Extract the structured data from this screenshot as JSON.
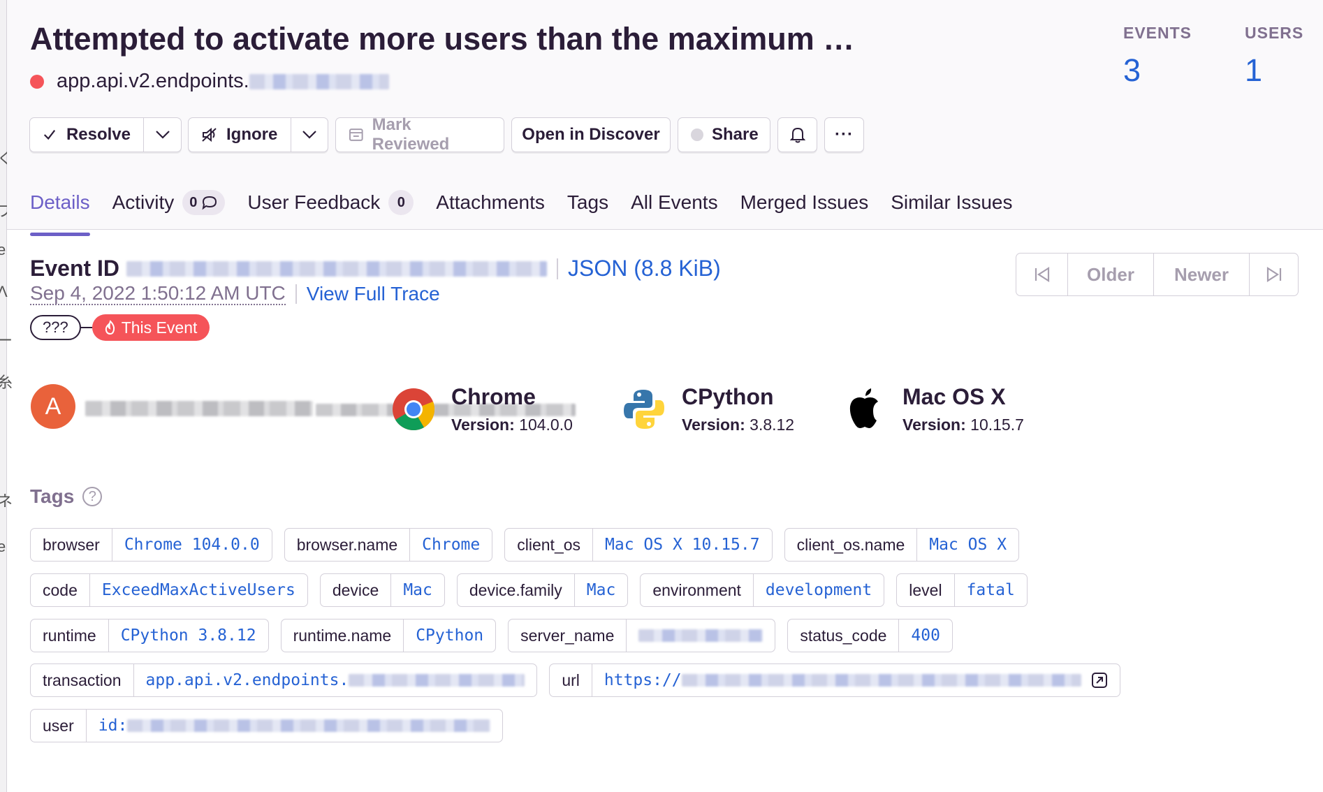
{
  "issue": {
    "title": "Attempted to activate more users than the maximum …",
    "culprit": "app.api.v2.endpoints."
  },
  "stats": [
    {
      "label": "EVENTS",
      "value": "3"
    },
    {
      "label": "USERS",
      "value": "1"
    }
  ],
  "actions": {
    "resolve": "Resolve",
    "ignore": "Ignore",
    "mark_reviewed": "Mark Reviewed",
    "open_discover": "Open in Discover",
    "share": "Share",
    "more": "···"
  },
  "tabs": [
    {
      "label": "Details"
    },
    {
      "label": "Activity",
      "badge": "0"
    },
    {
      "label": "User Feedback",
      "badge": "0"
    },
    {
      "label": "Attachments"
    },
    {
      "label": "Tags"
    },
    {
      "label": "All Events"
    },
    {
      "label": "Merged Issues"
    },
    {
      "label": "Similar Issues"
    }
  ],
  "event": {
    "id_label": "Event ID",
    "json_link": "JSON (8.8 KiB)",
    "date": "Sep 4, 2022 1:50:12 AM UTC",
    "trace_link": "View Full Trace",
    "trace_unknown": "???",
    "this_event": "This Event"
  },
  "pager": {
    "older": "Older",
    "newer": "Newer"
  },
  "contexts": {
    "user_initial": "A",
    "browser": {
      "name": "Chrome",
      "version_label": "Version:",
      "version": "104.0.0"
    },
    "runtime": {
      "name": "CPython",
      "version_label": "Version:",
      "version": "3.8.12"
    },
    "os": {
      "name": "Mac OS X",
      "version_label": "Version:",
      "version": "10.15.7"
    }
  },
  "tags_title": "Tags",
  "tags": [
    {
      "key": "browser",
      "value": "Chrome 104.0.0"
    },
    {
      "key": "browser.name",
      "value": "Chrome"
    },
    {
      "key": "client_os",
      "value": "Mac OS X 10.15.7"
    },
    {
      "key": "client_os.name",
      "value": "Mac OS X"
    },
    {
      "key": "code",
      "value": "ExceedMaxActiveUsers"
    },
    {
      "key": "device",
      "value": "Mac"
    },
    {
      "key": "device.family",
      "value": "Mac"
    },
    {
      "key": "environment",
      "value": "development"
    },
    {
      "key": "level",
      "value": "fatal"
    },
    {
      "key": "runtime",
      "value": "CPython 3.8.12"
    },
    {
      "key": "runtime.name",
      "value": "CPython"
    },
    {
      "key": "server_name",
      "value": ""
    },
    {
      "key": "status_code",
      "value": "400"
    },
    {
      "key": "transaction",
      "value": "app.api.v2.endpoints."
    },
    {
      "key": "url",
      "value": "https://"
    },
    {
      "key": "user",
      "value": "id:"
    }
  ],
  "colors": {
    "accent": "#6c5fc7",
    "link": "#2562d4",
    "danger": "#f55459",
    "avatar": "#e9623b"
  }
}
